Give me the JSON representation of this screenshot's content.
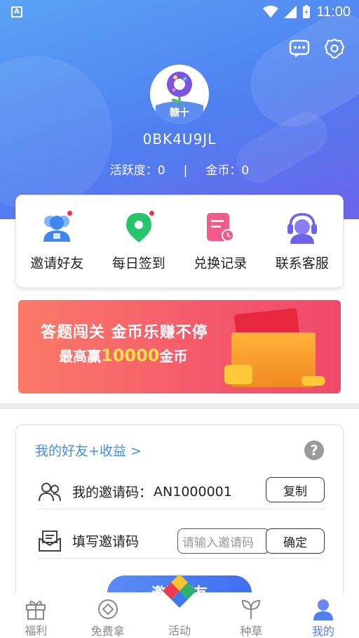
{
  "status_bar": {
    "left_icon_letter": "A",
    "time": "11:00"
  },
  "header": {
    "avatar_logo_text": "糖十",
    "username": "0BK4U9JL",
    "activity_label": "活跃度：0",
    "separator": "|",
    "coins_label": "金币：0",
    "icons": [
      "message-icon",
      "settings-icon"
    ]
  },
  "quick_actions": [
    {
      "label": "邀请好友",
      "icon": "friends-icon",
      "color": "#3f86f0",
      "badge": true
    },
    {
      "label": "每日签到",
      "icon": "location-pin-icon",
      "color": "#27c46b",
      "badge": true
    },
    {
      "label": "兑换记录",
      "icon": "record-icon",
      "color": "#f25a8a",
      "badge": false
    },
    {
      "label": "联系客服",
      "icon": "headset-icon",
      "color": "#6d63ea",
      "badge": false
    }
  ],
  "banner": {
    "line1": "答题闯关 金币乐赚不停",
    "line2_prefix": "最高赢",
    "line2_number": "10000",
    "line2_suffix": "金币"
  },
  "friends_card": {
    "title": "我的好友+收益 >",
    "help_symbol": "?",
    "my_code_label": "我的邀请码：",
    "my_code_value": "AN1000001",
    "copy_button": "复制",
    "fill_code_label": "填写邀请码",
    "fill_code_placeholder": "请输入邀请码",
    "confirm_button": "确定",
    "invite_button": "邀请好友"
  },
  "tabbar": [
    {
      "label": "福利",
      "icon": "gift-icon",
      "active": false
    },
    {
      "label": "免费拿",
      "icon": "coin-icon",
      "active": false
    },
    {
      "label": "活动",
      "icon": "activity-logo-icon",
      "active": false
    },
    {
      "label": "种草",
      "icon": "sprout-icon",
      "active": false
    },
    {
      "label": "我的",
      "icon": "user-icon",
      "active": true
    }
  ],
  "colors": {
    "accent": "#4f7ff0",
    "link": "#4a8de0",
    "badge": "#f0314b"
  }
}
